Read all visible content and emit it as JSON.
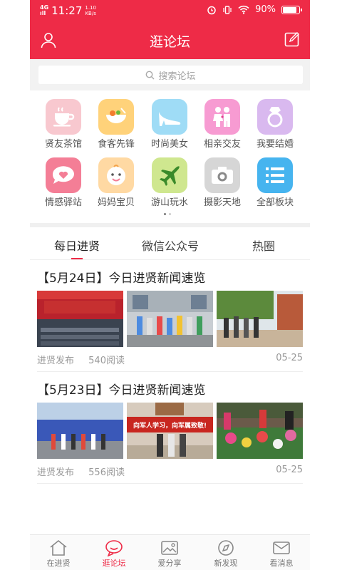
{
  "status": {
    "network": "4G",
    "signal": "ıll",
    "time": "11:27",
    "speed_value": "1.10",
    "speed_unit": "KB/s",
    "battery": "90%"
  },
  "header": {
    "title": "逛论坛"
  },
  "search": {
    "placeholder": "搜索论坛"
  },
  "categories": [
    {
      "label": "贤友茶馆",
      "color": "#f8c8cf"
    },
    {
      "label": "食客先锋",
      "color": "#ffd27a"
    },
    {
      "label": "时尚美女",
      "color": "#9fdcf6"
    },
    {
      "label": "相亲交友",
      "color": "#f79bd2"
    },
    {
      "label": "我要结婚",
      "color": "#d9b9ef"
    },
    {
      "label": "情感驿站",
      "color": "#f47e96"
    },
    {
      "label": "妈妈宝贝",
      "color": "#ffd9a3"
    },
    {
      "label": "游山玩水",
      "color": "#cfe78f"
    },
    {
      "label": "摄影天地",
      "color": "#d6d6d6"
    },
    {
      "label": "全部板块",
      "color": "#46b4ef"
    }
  ],
  "tabs": [
    "每日进贤",
    "微信公众号",
    "热圈"
  ],
  "news": [
    {
      "title": "【5月24日】今日进贤新闻速览",
      "source": "进贤发布",
      "reads": "540阅读",
      "date": "05-25",
      "banner": ""
    },
    {
      "title": "【5月23日】今日进贤新闻速览",
      "source": "进贤发布",
      "reads": "556阅读",
      "date": "05-25",
      "banner": "向军人学习，向军属致敬!"
    }
  ],
  "nav": [
    "在进贤",
    "逛论坛",
    "爱分享",
    "新发现",
    "看消息"
  ],
  "colors": {
    "accent": "#ee2b47"
  }
}
